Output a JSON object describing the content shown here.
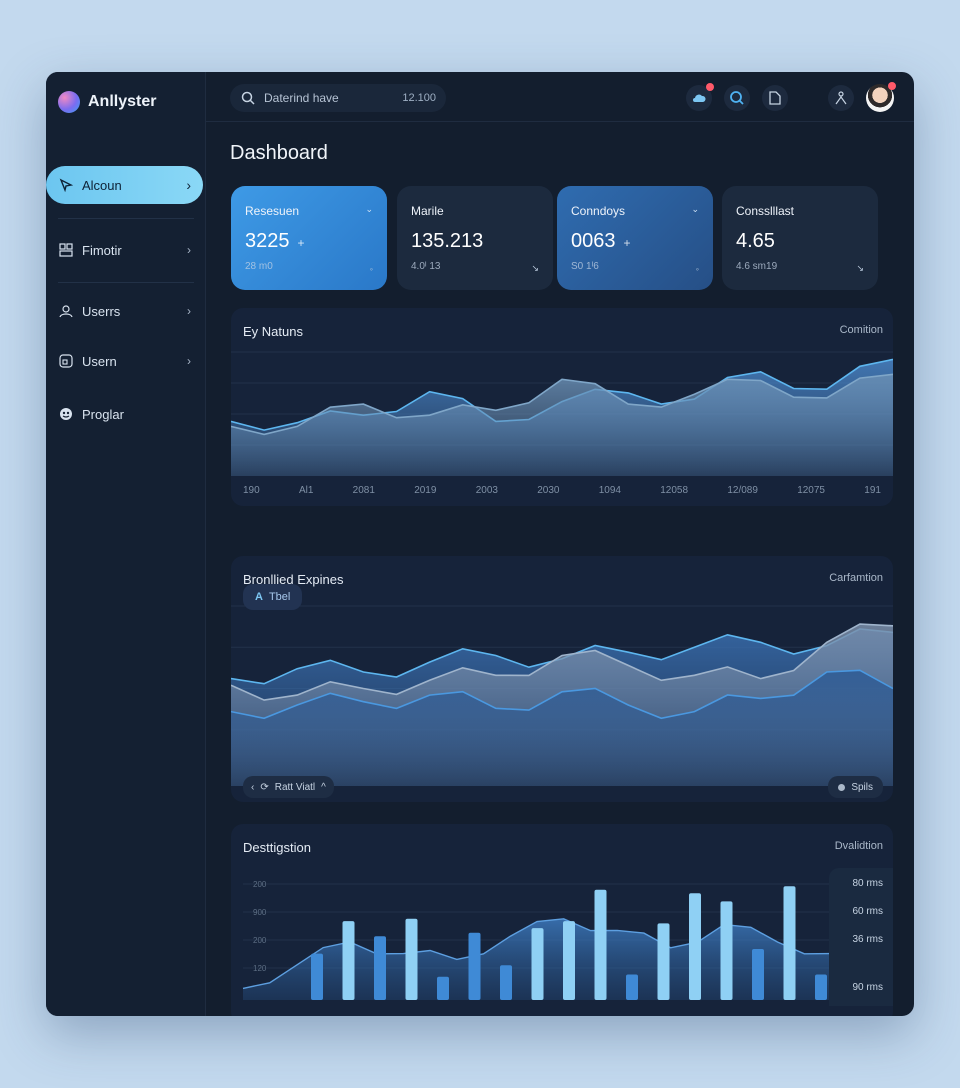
{
  "app": {
    "name": "Anllyster"
  },
  "search": {
    "placeholder": "Daterind have",
    "count": "12.100"
  },
  "sidebar": {
    "items": [
      {
        "label": "Alcoun",
        "active": true
      },
      {
        "label": "Fimotir"
      },
      {
        "label": "Userrs"
      },
      {
        "label": "Usern"
      },
      {
        "label": "Proglar"
      }
    ]
  },
  "page": {
    "title": "Dashboard"
  },
  "cards": [
    {
      "label": "Resesuen",
      "value": "3225",
      "sub": "28 m0"
    },
    {
      "label": "Marile",
      "value": "135.213",
      "sub": "4.0ᴵ 13"
    },
    {
      "label": "Conndoys",
      "value": "0063",
      "sub": "S0 1ᴵ6"
    },
    {
      "label": "Consslllast",
      "value": "4.65",
      "sub": "4.6 sm19"
    }
  ],
  "panels": {
    "p1": {
      "title": "Ey Natuns",
      "right": "Comition",
      "x_labels": [
        "190",
        "Al1",
        "2081",
        "2019",
        "2003",
        "2030",
        "1094",
        "12058",
        "12/089",
        "12075",
        "191"
      ]
    },
    "p2": {
      "title": "Bronllied Expines",
      "right": "Carfamtion",
      "chip": "Tbel",
      "filter": "Ratt Viatl",
      "button": "Spils"
    },
    "p3": {
      "title": "Desttigstion",
      "right": "Dvalidtion",
      "y_labels": [
        "200",
        "900",
        "200",
        "120"
      ],
      "legend": [
        "80 rms",
        "60 rms",
        "36 rms",
        "90 rms"
      ]
    }
  },
  "chart_data": [
    {
      "type": "area",
      "title": "Ey Natuns",
      "categories": [
        "190",
        "Al1",
        "2081",
        "2019",
        "2003",
        "2030",
        "1094",
        "12058",
        "12/089",
        "12075",
        "191"
      ],
      "series": [
        {
          "values": [
            44,
            43,
            49,
            68,
            44,
            60,
            67,
            62,
            84,
            70,
            94
          ]
        },
        {
          "values": [
            40,
            40,
            58,
            49,
            53,
            78,
            58,
            66,
            77,
            63,
            82
          ]
        }
      ],
      "ylim": [
        0,
        100
      ]
    },
    {
      "type": "area",
      "title": "Bronllied Expines",
      "series": [
        {
          "values": [
            56,
            62,
            60,
            66,
            70,
            68,
            72,
            75,
            78,
            76,
            84
          ]
        },
        {
          "values": [
            52,
            46,
            50,
            55,
            58,
            70,
            64,
            58,
            56,
            78,
            88
          ]
        },
        {
          "values": [
            36,
            40,
            42,
            46,
            38,
            48,
            40,
            36,
            44,
            60,
            50
          ]
        }
      ],
      "ylim": [
        0,
        100
      ]
    },
    {
      "type": "bar",
      "title": "Desttigstion",
      "values": [
        40,
        68,
        55,
        70,
        20,
        58,
        30,
        62,
        68,
        95,
        22,
        66,
        92,
        85,
        44,
        98,
        22
      ],
      "ylim": [
        0,
        100
      ]
    }
  ],
  "colors": {
    "accent": "#6cc6f0",
    "card_blue": "#3e9ae6",
    "line": "#5db6ef",
    "background": "#131e2e"
  }
}
